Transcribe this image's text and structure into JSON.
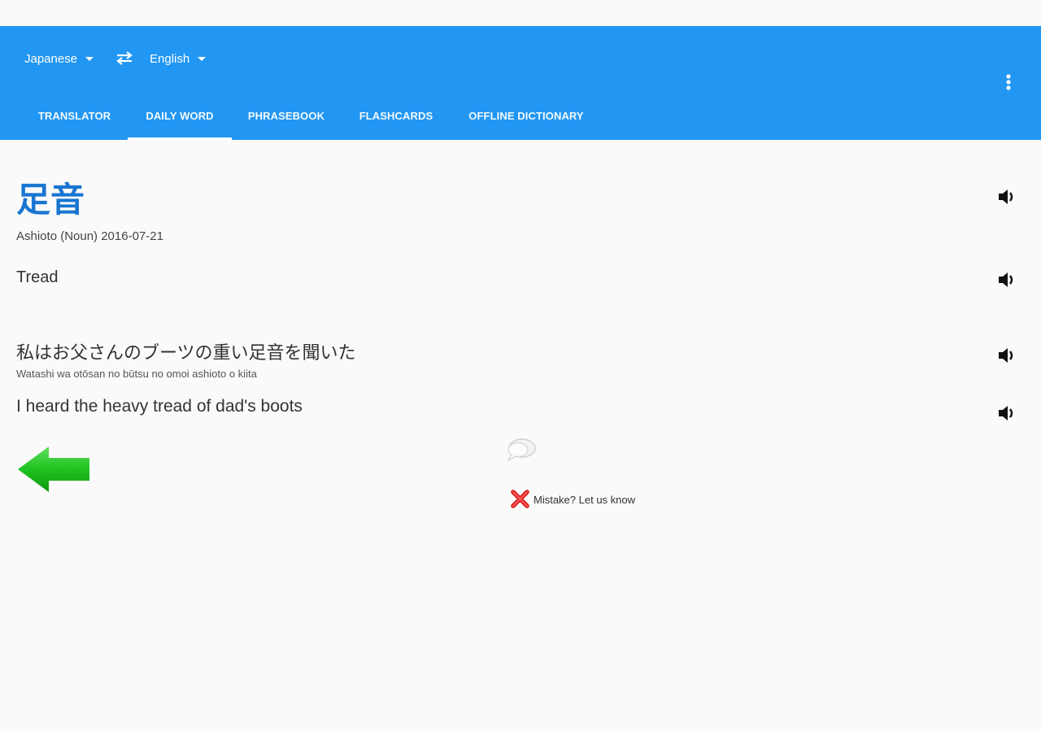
{
  "header": {
    "source_language": "Japanese",
    "target_language": "English",
    "icons": {
      "swap": "swap-languages-icon",
      "overflow": "more-vertical-icon"
    },
    "colors": {
      "app_bar": "#2196f3",
      "accent_text": "#1976d2"
    }
  },
  "tabs": [
    {
      "label": "TRANSLATOR",
      "active": false
    },
    {
      "label": "DAILY WORD",
      "active": true
    },
    {
      "label": "PHRASEBOOK",
      "active": false
    },
    {
      "label": "FLASHCARDS",
      "active": false
    },
    {
      "label": "OFFLINE DICTIONARY",
      "active": false
    }
  ],
  "daily_word": {
    "word": "足音",
    "meta": "Ashioto (Noun) 2016-07-21",
    "meaning": "Tread",
    "example_sentence": "私はお父さんのブーツの重い足音を聞いた",
    "example_romaji": "Watashi wa otōsan no būtsu no omoi ashioto o kiita",
    "example_translation": "I heard the heavy tread of dad's boots"
  },
  "footer": {
    "mistake_label": "Mistake? Let us know",
    "icons": {
      "back": "back-arrow-icon",
      "comment": "comment-bubble-icon",
      "mistake": "red-x-icon"
    }
  }
}
